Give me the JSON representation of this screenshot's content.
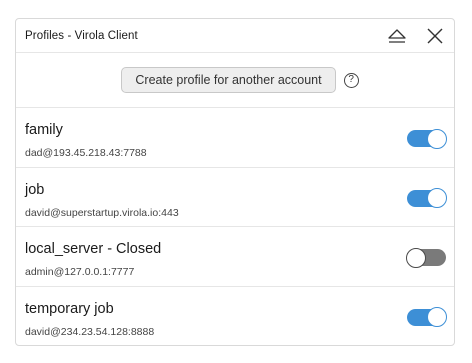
{
  "window": {
    "title": "Profiles - Virola Client"
  },
  "toolbar": {
    "create_label": "Create profile for another account",
    "help_glyph": "?"
  },
  "profiles": [
    {
      "name": "family",
      "address": "dad@193.45.218.43:7788",
      "enabled": true
    },
    {
      "name": "job",
      "address": "david@superstartup.virola.io:443",
      "enabled": true
    },
    {
      "name": "local_server - Closed",
      "address": "admin@127.0.0.1:7777",
      "enabled": false
    },
    {
      "name": "temporary job",
      "address": "david@234.23.54.128:8888",
      "enabled": true
    }
  ],
  "colors": {
    "accent": "#3d8fd6",
    "toggle_off": "#7a7a7a"
  }
}
